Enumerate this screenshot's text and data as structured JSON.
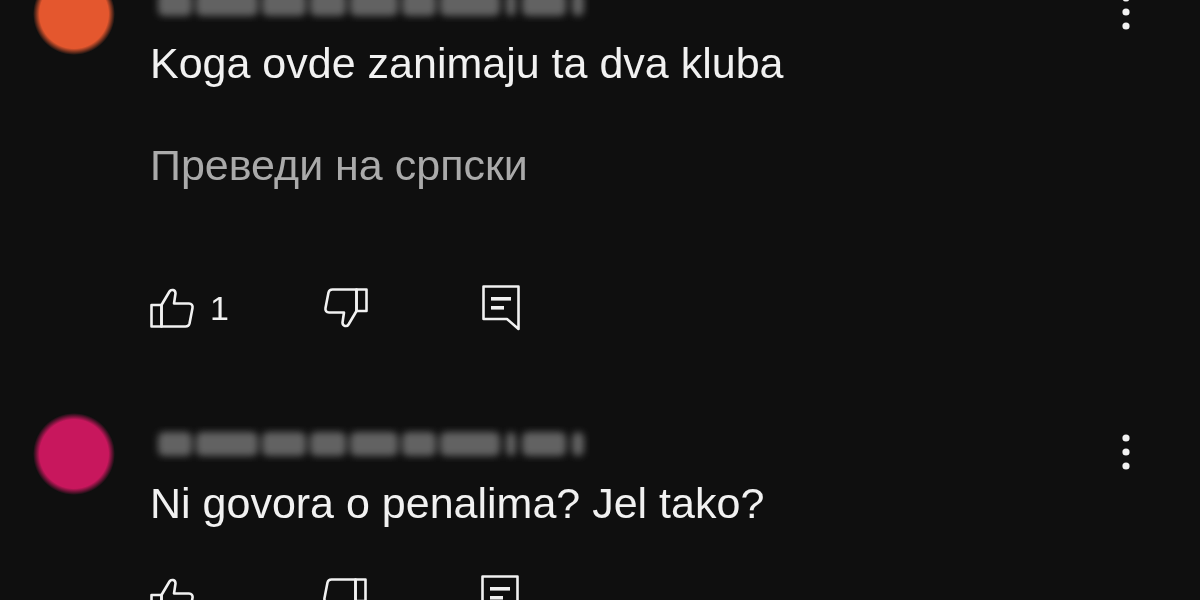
{
  "comments": [
    {
      "avatar": {
        "color": "#e4572e"
      },
      "text": "Koga ovde zanimaju ta dva kluba",
      "translate_link": "Преведи на српски",
      "actions": [
        {
          "kind": "like",
          "count": "1"
        },
        {
          "kind": "dislike"
        },
        {
          "kind": "reply"
        }
      ]
    },
    {
      "avatar": {
        "color": "#c8175d"
      },
      "text": "Ni govora o penalima? Jel tako?",
      "actions": [
        {
          "kind": "like"
        },
        {
          "kind": "dislike"
        },
        {
          "kind": "reply"
        }
      ]
    }
  ]
}
